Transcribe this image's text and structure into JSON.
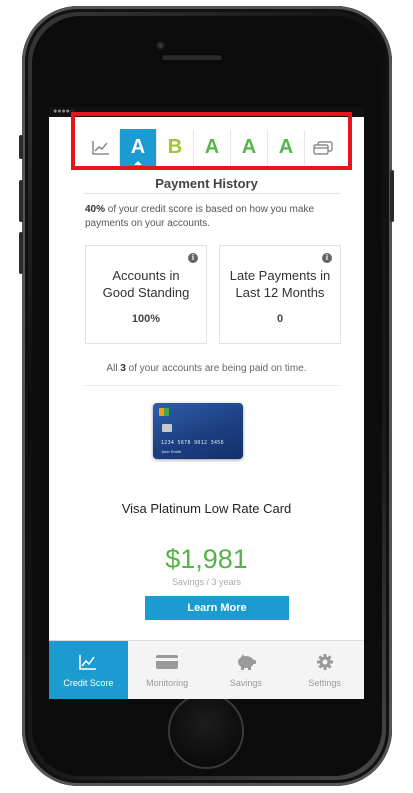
{
  "colors": {
    "accent_blue": "#1b9bd0",
    "grade_green": "#53b848",
    "grade_light_green": "#9bc53d",
    "savings_green": "#55b447",
    "highlight_red": "#e8141b"
  },
  "grade_tabs": [
    {
      "type": "icon",
      "icon": "line-chart-icon"
    },
    {
      "type": "grade",
      "label": "A",
      "active": true
    },
    {
      "type": "grade",
      "label": "B"
    },
    {
      "type": "grade",
      "label": "A"
    },
    {
      "type": "grade",
      "label": "A"
    },
    {
      "type": "grade",
      "label": "A"
    },
    {
      "type": "icon",
      "icon": "cards-icon"
    }
  ],
  "section": {
    "title": "Payment History",
    "intro_bold": "40%",
    "intro_rest": " of your credit score is based on how you make payments on your accounts."
  },
  "stats": [
    {
      "label_line1": "Accounts in",
      "label_line2": "Good Standing",
      "value": "100%"
    },
    {
      "label_line1": "Late Payments in",
      "label_line2": "Last 12 Months",
      "value": "0"
    }
  ],
  "paid": {
    "prefix": "All ",
    "count": "3",
    "suffix": " of your accounts are being paid on time."
  },
  "offer": {
    "card_number": "1234 5678 9012 3456",
    "card_holder": "John Smith",
    "card_name": "Visa Platinum Low Rate Card",
    "savings_amount": "$1,981",
    "savings_label": "Savings / 3 years",
    "cta_label": "Learn More"
  },
  "nav": [
    {
      "label": "Credit Score",
      "icon": "line-chart-icon",
      "active": true
    },
    {
      "label": "Monitoring",
      "icon": "credit-card-icon"
    },
    {
      "label": "Savings",
      "icon": "piggy-bank-icon"
    },
    {
      "label": "Settings",
      "icon": "gear-icon"
    }
  ]
}
